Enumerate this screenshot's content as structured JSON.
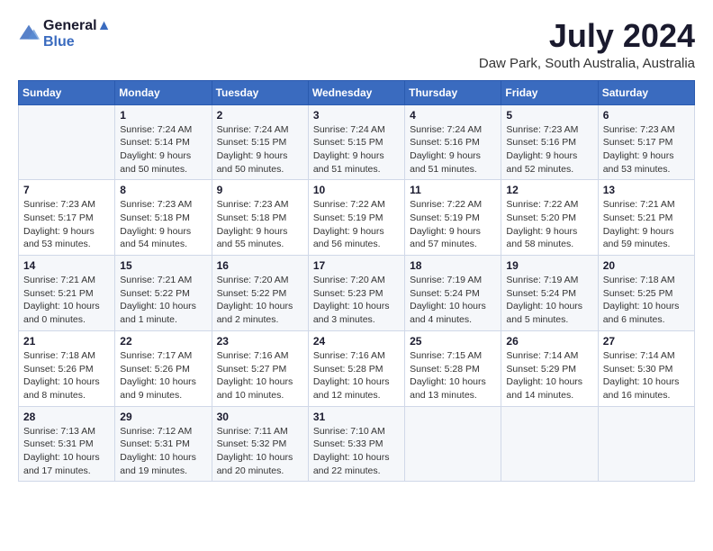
{
  "header": {
    "logo_line1": "General",
    "logo_line2": "Blue",
    "month_year": "July 2024",
    "location": "Daw Park, South Australia, Australia"
  },
  "weekdays": [
    "Sunday",
    "Monday",
    "Tuesday",
    "Wednesday",
    "Thursday",
    "Friday",
    "Saturday"
  ],
  "weeks": [
    [
      {
        "day": "",
        "sunrise": "",
        "sunset": "",
        "daylight": ""
      },
      {
        "day": "1",
        "sunrise": "7:24 AM",
        "sunset": "5:14 PM",
        "daylight": "9 hours and 50 minutes."
      },
      {
        "day": "2",
        "sunrise": "7:24 AM",
        "sunset": "5:15 PM",
        "daylight": "9 hours and 50 minutes."
      },
      {
        "day": "3",
        "sunrise": "7:24 AM",
        "sunset": "5:15 PM",
        "daylight": "9 hours and 51 minutes."
      },
      {
        "day": "4",
        "sunrise": "7:24 AM",
        "sunset": "5:16 PM",
        "daylight": "9 hours and 51 minutes."
      },
      {
        "day": "5",
        "sunrise": "7:23 AM",
        "sunset": "5:16 PM",
        "daylight": "9 hours and 52 minutes."
      },
      {
        "day": "6",
        "sunrise": "7:23 AM",
        "sunset": "5:17 PM",
        "daylight": "9 hours and 53 minutes."
      }
    ],
    [
      {
        "day": "7",
        "sunrise": "7:23 AM",
        "sunset": "5:17 PM",
        "daylight": "9 hours and 53 minutes."
      },
      {
        "day": "8",
        "sunrise": "7:23 AM",
        "sunset": "5:18 PM",
        "daylight": "9 hours and 54 minutes."
      },
      {
        "day": "9",
        "sunrise": "7:23 AM",
        "sunset": "5:18 PM",
        "daylight": "9 hours and 55 minutes."
      },
      {
        "day": "10",
        "sunrise": "7:22 AM",
        "sunset": "5:19 PM",
        "daylight": "9 hours and 56 minutes."
      },
      {
        "day": "11",
        "sunrise": "7:22 AM",
        "sunset": "5:19 PM",
        "daylight": "9 hours and 57 minutes."
      },
      {
        "day": "12",
        "sunrise": "7:22 AM",
        "sunset": "5:20 PM",
        "daylight": "9 hours and 58 minutes."
      },
      {
        "day": "13",
        "sunrise": "7:21 AM",
        "sunset": "5:21 PM",
        "daylight": "9 hours and 59 minutes."
      }
    ],
    [
      {
        "day": "14",
        "sunrise": "7:21 AM",
        "sunset": "5:21 PM",
        "daylight": "10 hours and 0 minutes."
      },
      {
        "day": "15",
        "sunrise": "7:21 AM",
        "sunset": "5:22 PM",
        "daylight": "10 hours and 1 minute."
      },
      {
        "day": "16",
        "sunrise": "7:20 AM",
        "sunset": "5:22 PM",
        "daylight": "10 hours and 2 minutes."
      },
      {
        "day": "17",
        "sunrise": "7:20 AM",
        "sunset": "5:23 PM",
        "daylight": "10 hours and 3 minutes."
      },
      {
        "day": "18",
        "sunrise": "7:19 AM",
        "sunset": "5:24 PM",
        "daylight": "10 hours and 4 minutes."
      },
      {
        "day": "19",
        "sunrise": "7:19 AM",
        "sunset": "5:24 PM",
        "daylight": "10 hours and 5 minutes."
      },
      {
        "day": "20",
        "sunrise": "7:18 AM",
        "sunset": "5:25 PM",
        "daylight": "10 hours and 6 minutes."
      }
    ],
    [
      {
        "day": "21",
        "sunrise": "7:18 AM",
        "sunset": "5:26 PM",
        "daylight": "10 hours and 8 minutes."
      },
      {
        "day": "22",
        "sunrise": "7:17 AM",
        "sunset": "5:26 PM",
        "daylight": "10 hours and 9 minutes."
      },
      {
        "day": "23",
        "sunrise": "7:16 AM",
        "sunset": "5:27 PM",
        "daylight": "10 hours and 10 minutes."
      },
      {
        "day": "24",
        "sunrise": "7:16 AM",
        "sunset": "5:28 PM",
        "daylight": "10 hours and 12 minutes."
      },
      {
        "day": "25",
        "sunrise": "7:15 AM",
        "sunset": "5:28 PM",
        "daylight": "10 hours and 13 minutes."
      },
      {
        "day": "26",
        "sunrise": "7:14 AM",
        "sunset": "5:29 PM",
        "daylight": "10 hours and 14 minutes."
      },
      {
        "day": "27",
        "sunrise": "7:14 AM",
        "sunset": "5:30 PM",
        "daylight": "10 hours and 16 minutes."
      }
    ],
    [
      {
        "day": "28",
        "sunrise": "7:13 AM",
        "sunset": "5:31 PM",
        "daylight": "10 hours and 17 minutes."
      },
      {
        "day": "29",
        "sunrise": "7:12 AM",
        "sunset": "5:31 PM",
        "daylight": "10 hours and 19 minutes."
      },
      {
        "day": "30",
        "sunrise": "7:11 AM",
        "sunset": "5:32 PM",
        "daylight": "10 hours and 20 minutes."
      },
      {
        "day": "31",
        "sunrise": "7:10 AM",
        "sunset": "5:33 PM",
        "daylight": "10 hours and 22 minutes."
      },
      {
        "day": "",
        "sunrise": "",
        "sunset": "",
        "daylight": ""
      },
      {
        "day": "",
        "sunrise": "",
        "sunset": "",
        "daylight": ""
      },
      {
        "day": "",
        "sunrise": "",
        "sunset": "",
        "daylight": ""
      }
    ]
  ],
  "labels": {
    "sunrise_prefix": "Sunrise: ",
    "sunset_prefix": "Sunset: ",
    "daylight_prefix": "Daylight: "
  }
}
